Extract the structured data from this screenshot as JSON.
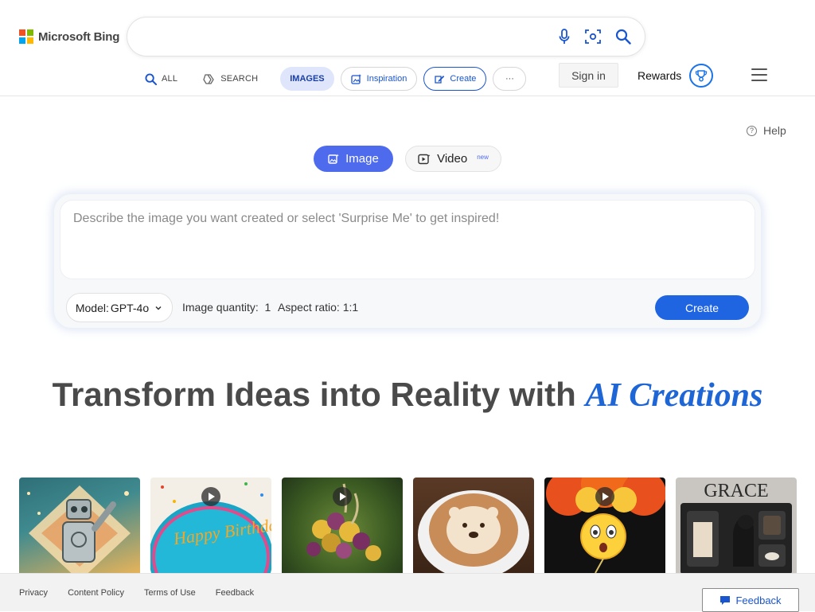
{
  "brand": {
    "name": "Microsoft Bing"
  },
  "search": {
    "value": "",
    "placeholder": ""
  },
  "nav": {
    "all": "ALL",
    "search": "SEARCH",
    "images": "IMAGES",
    "inspiration": "Inspiration",
    "create": "Create",
    "more": "···"
  },
  "account": {
    "sign_in": "Sign in",
    "rewards": "Rewards"
  },
  "help": {
    "label": "Help"
  },
  "modes": {
    "image": "Image",
    "video": "Video",
    "video_badge": "new",
    "selected": "Image"
  },
  "prompt": {
    "value": "",
    "placeholder": "Describe the image you want created or select 'Surprise Me' to get inspired!"
  },
  "options": {
    "model_label": "Model:",
    "model_value": "GPT-4o",
    "quantity": "Image quantity:  1",
    "aspect_ratio": "Aspect ratio: 1:1",
    "create_button": "Create"
  },
  "hero": {
    "text": "Transform Ideas into Reality with ",
    "accent": "AI Creations"
  },
  "gallery": [
    {
      "name": "robot-art",
      "video": false,
      "text": ""
    },
    {
      "name": "birthday-cake",
      "video": true,
      "text": "Happy Birthday"
    },
    {
      "name": "flower-creature",
      "video": true,
      "text": ""
    },
    {
      "name": "otter-latte",
      "video": false,
      "text": ""
    },
    {
      "name": "shocked-emoji",
      "video": true,
      "text": ""
    },
    {
      "name": "grace-dog",
      "video": false,
      "text": "GRACE"
    }
  ],
  "footer": {
    "privacy": "Privacy",
    "content_policy": "Content Policy",
    "terms": "Terms of Use",
    "feedback_link": "Feedback",
    "feedback_button": "Feedback"
  },
  "colors": {
    "accent": "#4f6bed",
    "create_button": "#1f64e0",
    "hero_accent": "#1e66d6"
  }
}
